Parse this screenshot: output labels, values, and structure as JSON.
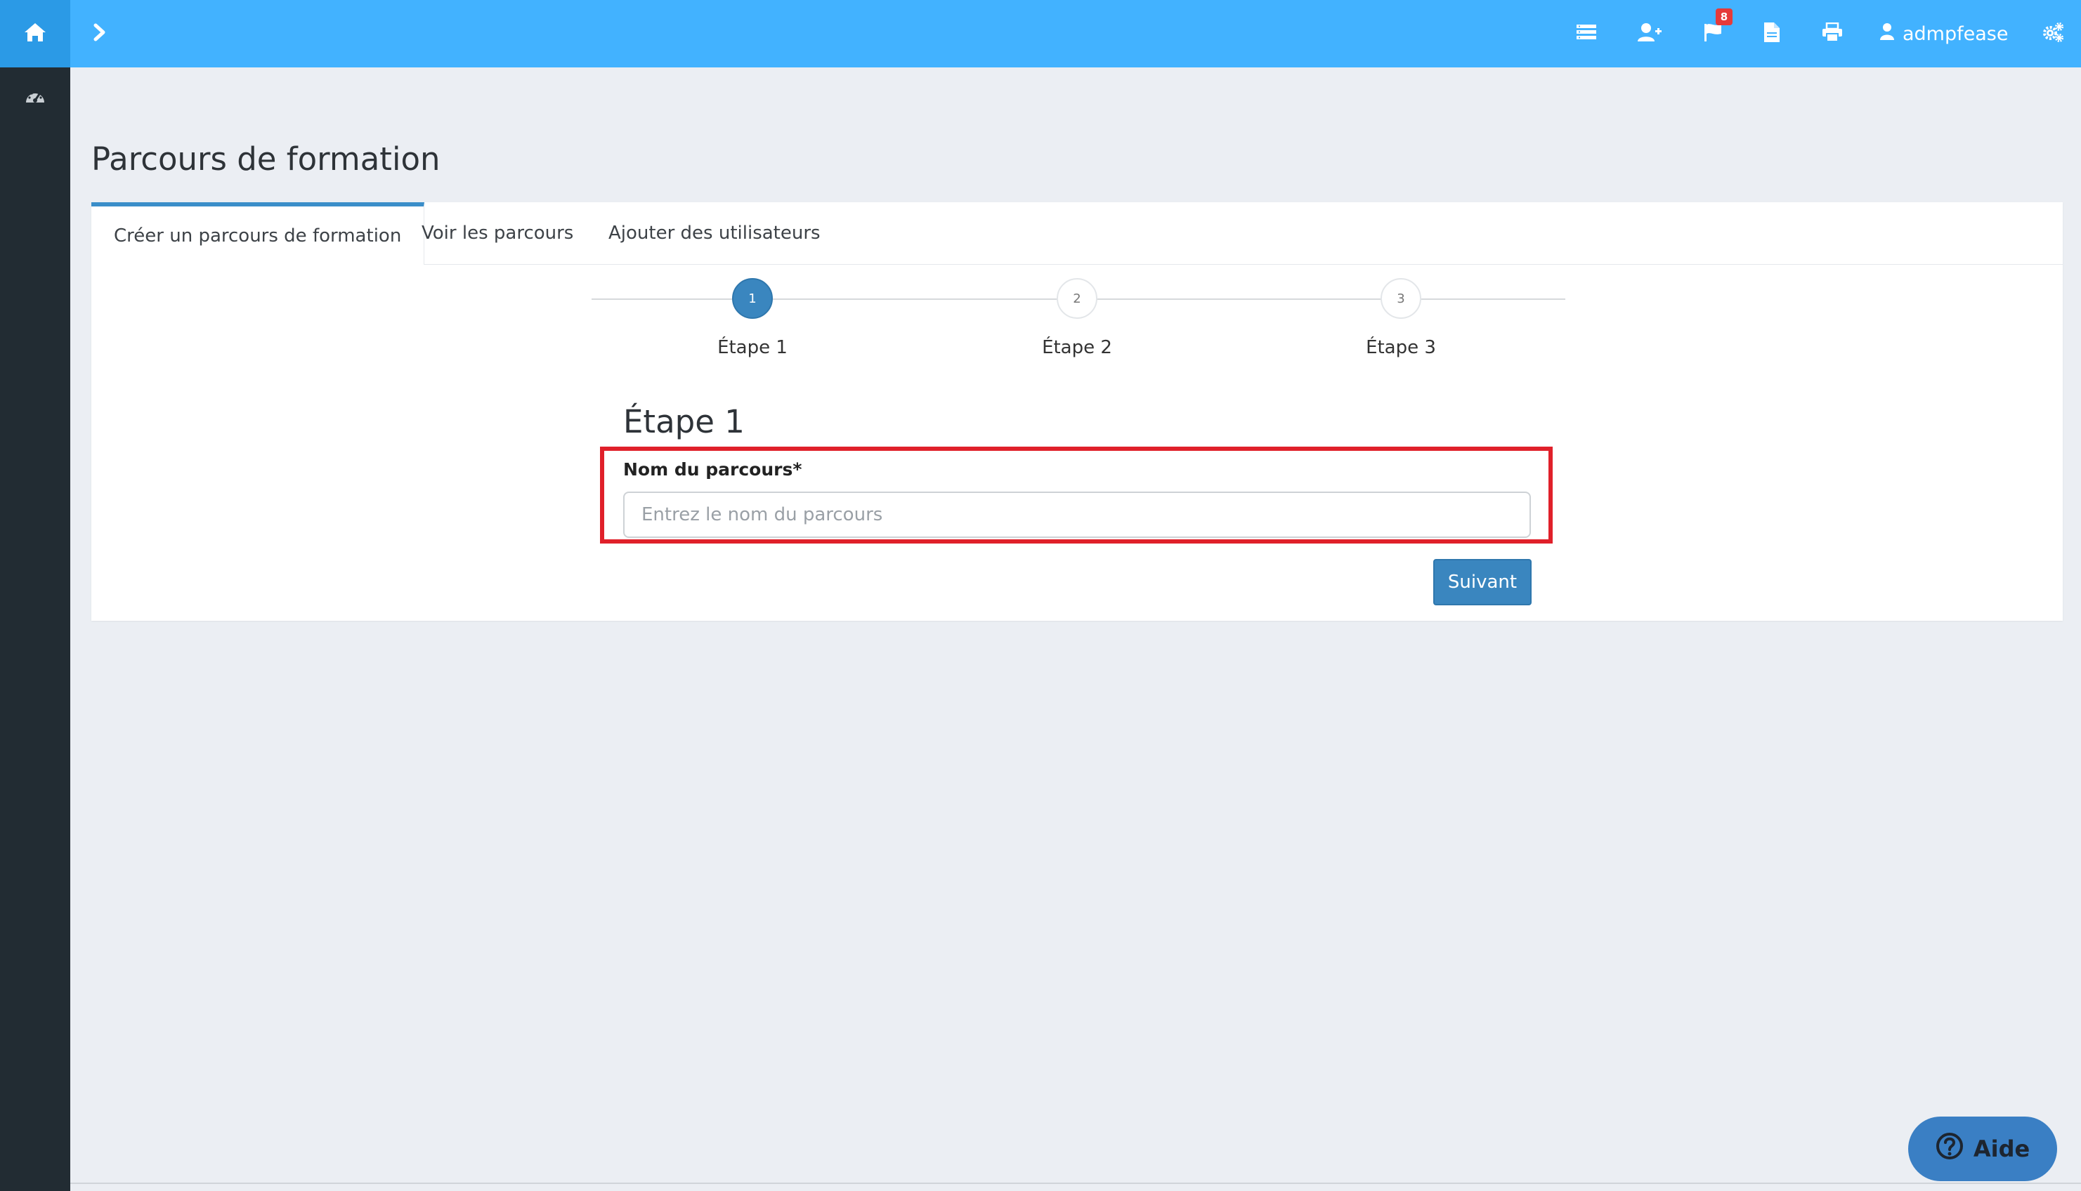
{
  "topbar": {
    "icons": [
      "home-icon",
      "chevron-right-icon",
      "list-icon",
      "user-plus-icon",
      "flag-icon",
      "file-icon",
      "print-icon",
      "user-icon",
      "cogs-icon"
    ],
    "notification_count": "8",
    "username": "admpfease",
    "color": "#42b2ff"
  },
  "sidebar": {
    "icons": [
      "dashboard-icon"
    ],
    "color": "#222c33"
  },
  "page": {
    "title": "Parcours de formation",
    "tabs": [
      {
        "label": "Créer un parcours de formation",
        "active": true
      },
      {
        "label": "Voir les parcours",
        "active": false
      },
      {
        "label": "Ajouter des utilisateurs",
        "active": false
      }
    ],
    "stepper": [
      {
        "number": "1",
        "label": "Étape 1",
        "active": true
      },
      {
        "number": "2",
        "label": "Étape 2",
        "active": false
      },
      {
        "number": "3",
        "label": "Étape 3",
        "active": false
      }
    ],
    "step_heading": "Étape 1",
    "form": {
      "name_label": "Nom du parcours*",
      "name_value": "",
      "name_placeholder": "Entrez le nom du parcours",
      "next_label": "Suivant"
    }
  },
  "help": {
    "label": "Aide"
  },
  "colors": {
    "accent": "#3a86bf",
    "highlight": "#e0202a"
  }
}
